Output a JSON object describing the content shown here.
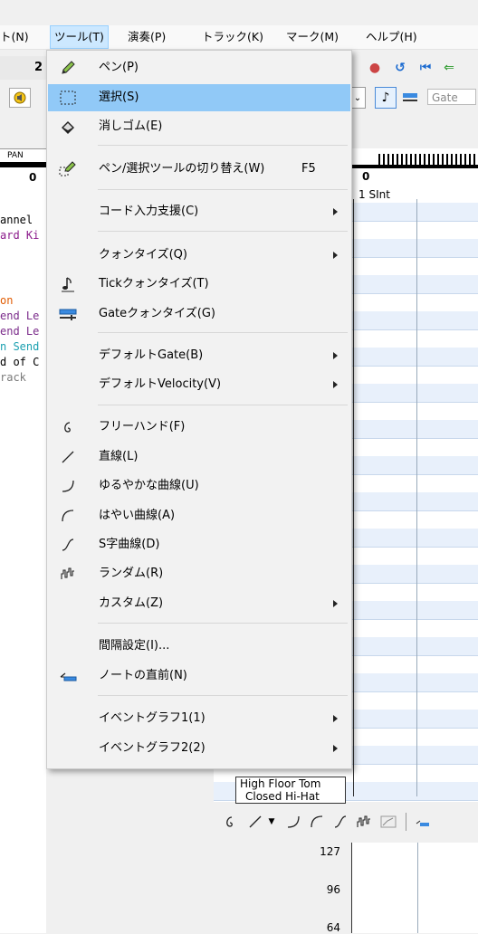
{
  "menubar": {
    "items": [
      "ト(N)",
      "ツール(T)",
      "演奏(P)",
      "トラック(K)",
      "マーク(M)",
      "ヘルプ(H)"
    ]
  },
  "toolbar": {
    "value": "2",
    "gate_label": "Gate"
  },
  "left_panel": {
    "pan_label": "PAN",
    "pan_value": "0",
    "right_value": "0"
  },
  "track_list": [
    {
      "text": "annel",
      "color": "#000000"
    },
    {
      "text": "ard Ki",
      "color": "#8a1a8a"
    },
    {
      "text": "on",
      "color": "#e05a00"
    },
    {
      "text": "end Le",
      "color": "#7a2a8a"
    },
    {
      "text": "end Le",
      "color": "#7a2a8a"
    },
    {
      "text": "n Send",
      "color": "#1ba0b0"
    },
    {
      "text": "d of C",
      "color": "#000000"
    },
    {
      "text": "rack",
      "color": "#7a7a7a"
    }
  ],
  "grid": {
    "header": "1 SInt"
  },
  "drum_labels": [
    "High Floor Tom",
    "Closed Hi-Hat"
  ],
  "graph": {
    "ticks": [
      "127",
      "96",
      "64"
    ]
  },
  "tools_menu": {
    "items": [
      {
        "icon": "pencil-icon",
        "label": "ペン(P)",
        "highlight": false
      },
      {
        "icon": "select-rect-icon",
        "label": "選択(S)",
        "highlight": true
      },
      {
        "icon": "eraser-icon",
        "label": "消しゴム(E)",
        "highlight": false
      },
      {
        "icon": "pen-select-toggle-icon",
        "label": "ペン/選択ツールの切り替え(W)",
        "shortcut": "F5",
        "highlight": false
      },
      {
        "icon": "",
        "label": "コード入力支援(C)",
        "submenu": true
      },
      {
        "icon": "",
        "label": "クォンタイズ(Q)",
        "submenu": true
      },
      {
        "icon": "tick-quantize-icon",
        "label": "Tickクォンタイズ(T)"
      },
      {
        "icon": "gate-quantize-icon",
        "label": "Gateクォンタイズ(G)"
      },
      {
        "icon": "",
        "label": "デフォルトGate(B)",
        "submenu": true
      },
      {
        "icon": "",
        "label": "デフォルトVelocity(V)",
        "submenu": true
      },
      {
        "icon": "freehand-icon",
        "label": "フリーハンド(F)"
      },
      {
        "icon": "line-icon",
        "label": "直線(L)"
      },
      {
        "icon": "gentle-curve-icon",
        "label": "ゆるやかな曲線(U)"
      },
      {
        "icon": "fast-curve-icon",
        "label": "はやい曲線(A)"
      },
      {
        "icon": "s-curve-icon",
        "label": "S字曲線(D)"
      },
      {
        "icon": "random-icon",
        "label": "ランダム(R)"
      },
      {
        "icon": "",
        "label": "カスタム(Z)",
        "submenu": true
      },
      {
        "icon": "",
        "label": "間隔設定(I)..."
      },
      {
        "icon": "before-note-icon",
        "label": "ノートの直前(N)"
      },
      {
        "icon": "",
        "label": "イベントグラフ1(1)",
        "submenu": true
      },
      {
        "icon": "",
        "label": "イベントグラフ2(2)",
        "submenu": true
      }
    ]
  },
  "colors": {
    "highlight": "#91c9f7",
    "menubar_open": "#cce8ff"
  }
}
